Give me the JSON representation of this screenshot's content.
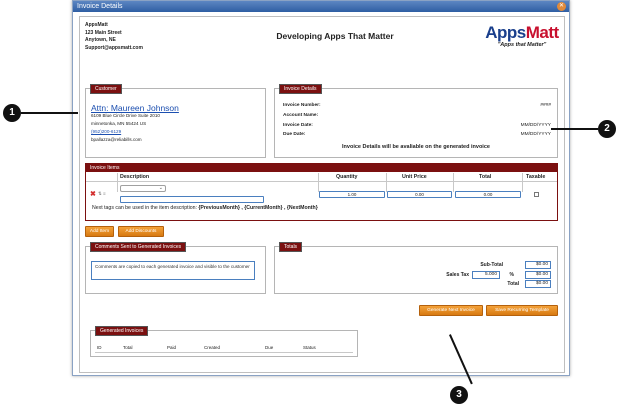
{
  "window": {
    "title": "Invoice Details"
  },
  "company": {
    "name": "AppsMatt",
    "address1": "123 Main Street",
    "address2": "Anytown, NE",
    "email": "Support@appsmatt.com",
    "tagline": "Developing Apps That Matter",
    "logo_text_a": "Apps",
    "logo_text_b": "Matt",
    "logo_tag": "\"Apps that Matter\""
  },
  "customer": {
    "legend": "Customer",
    "attn": "Attn: Maureen Johnson",
    "street": "6109 Blue Circle Drive Suite 2010",
    "city": "minnetonka, MN 55424 US",
    "phone": "(952)200-6129",
    "email": "bpallazza@reliabills.com"
  },
  "invoice_details": {
    "legend": "Invoice Details",
    "number_label": "Invoice Number:",
    "number_value": "####",
    "account_label": "Account Name:",
    "date_label": "Invoice Date:",
    "date_value": "MM/DD/YYYY",
    "due_label": "Due Date:",
    "due_value": "MM/DD/YYYY",
    "note": "Invoice Details will be avaliable on the generated invoice"
  },
  "items": {
    "legend": "Invoice Items",
    "columns": {
      "description": "Description",
      "quantity": "Quantity",
      "unit_price": "Unit Price",
      "total": "Total",
      "taxable": "Taxable"
    },
    "row": {
      "quantity": "1.00",
      "unit_price": "0.00",
      "total": "0.00"
    },
    "tags_prefix": "Next tags can be used in the item description: ",
    "tags": "{PreviousMonth} , {CurrentMonth} , {NextMonth}",
    "add_item": "Add Item",
    "add_discounts": "Add Discounts"
  },
  "comments": {
    "legend": "Comments Sent to Generated Invoices",
    "text": "Comments are copied to each generated invoice and visible to the customer"
  },
  "totals": {
    "legend": "Totals",
    "subtotal_label": "Sub-Total",
    "subtotal_value": "$0.00",
    "tax_label": "Sales Tax",
    "tax_rate": "5.000",
    "tax_pct": "%",
    "tax_value": "$0.00",
    "total_label": "Total",
    "total_value": "$0.00"
  },
  "actions": {
    "generate_next": "Generate Next Invoice",
    "save_template": "Save Recurring Template"
  },
  "generated": {
    "legend": "Generated Invoices",
    "columns": [
      "ID",
      "Total",
      "Paid",
      "Created",
      "Due",
      "Status"
    ]
  },
  "callouts": [
    "1",
    "2",
    "3"
  ]
}
